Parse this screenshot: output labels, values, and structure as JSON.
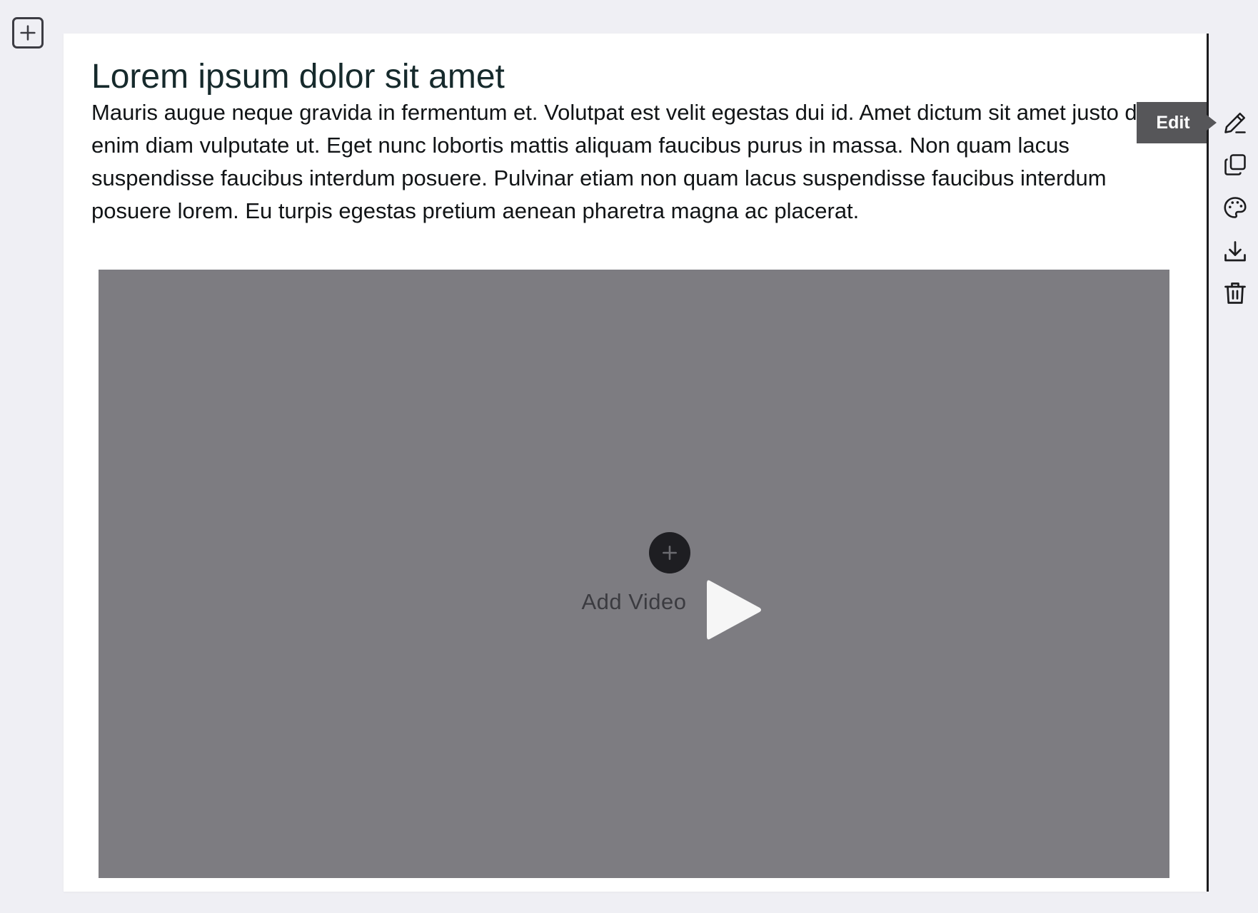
{
  "block": {
    "title": "Lorem ipsum dolor sit amet",
    "body": "Mauris augue neque gravida in fermentum et. Volutpat est velit egestas dui id. Amet dictum sit amet justo donec enim diam vulputate ut. Eget nunc lobortis mattis aliquam faucibus purus in massa. Non quam lacus suspendisse faucibus interdum posuere. Pulvinar etiam non quam lacus suspendisse faucibus interdum posuere lorem. Eu turpis egestas pretium aenean pharetra magna ac placerat."
  },
  "video": {
    "add_label": "Add Video"
  },
  "tooltip": {
    "label": "Edit"
  },
  "toolbar": {
    "items": [
      {
        "icon": "pencil-icon"
      },
      {
        "icon": "duplicate-icon"
      },
      {
        "icon": "palette-icon"
      },
      {
        "icon": "download-icon"
      },
      {
        "icon": "trash-icon"
      }
    ]
  },
  "colors": {
    "page_background": "#efeff4",
    "card_background": "#ffffff",
    "video_placeholder": "#7d7c81",
    "tooltip_background": "#565659",
    "icon": "#1c1c1e"
  }
}
